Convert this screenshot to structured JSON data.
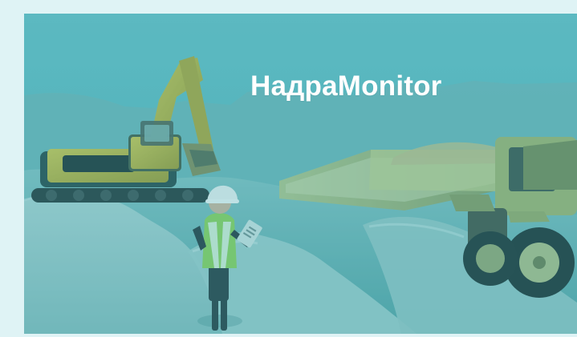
{
  "hero": {
    "brand_title": "НадраMonitor",
    "overlay_color": "#2aa5b0",
    "scene_icons": [
      "excavator-icon",
      "dump-truck-icon",
      "worker-icon",
      "hard-hat-icon",
      "clipboard-icon",
      "soil-pile-icon",
      "earth-ground-icon"
    ]
  }
}
